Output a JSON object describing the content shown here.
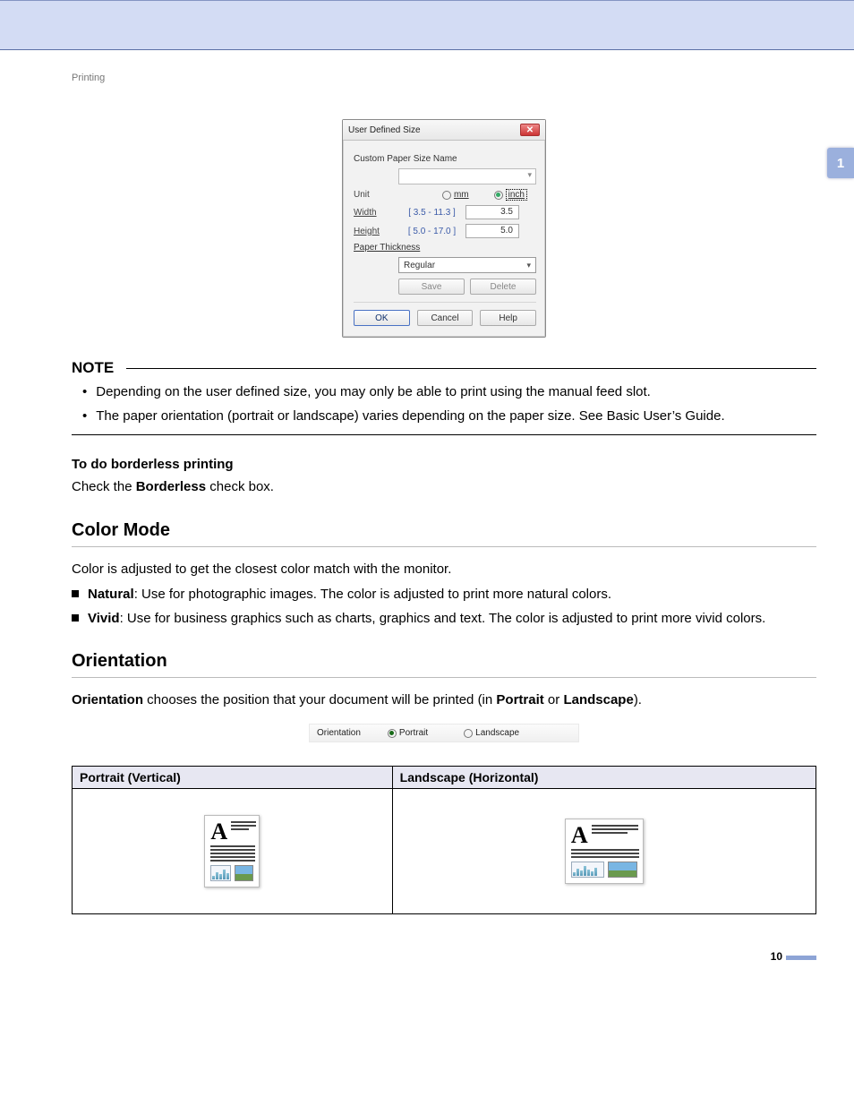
{
  "breadcrumb": "Printing",
  "chapter_tab": "1",
  "page_number": "10",
  "dialog": {
    "title": "User Defined Size",
    "label_custom_name": "Custom Paper Size Name",
    "name_value": "",
    "label_unit": "Unit",
    "radio_mm": "mm",
    "radio_inch": "inch",
    "label_width": "Width",
    "range_width": "[ 3.5 - 11.3 ]",
    "value_width": "3.5",
    "label_height": "Height",
    "range_height": "[ 5.0 - 17.0 ]",
    "value_height": "5.0",
    "label_thickness": "Paper Thickness",
    "thickness_value": "Regular",
    "btn_save": "Save",
    "btn_delete": "Delete",
    "btn_ok": "OK",
    "btn_cancel": "Cancel",
    "btn_help": "Help"
  },
  "note": {
    "heading": "NOTE",
    "items": [
      "Depending on the user defined size, you may only be able to print using the manual feed slot.",
      "The paper orientation (portrait or landscape) varies depending on the paper size. See Basic User’s Guide."
    ]
  },
  "borderless": {
    "heading": "To do borderless printing",
    "text_pre": "Check the ",
    "text_bold": "Borderless",
    "text_post": " check box."
  },
  "color_mode": {
    "heading": "Color Mode",
    "intro": "Color is adjusted to get the closest color match with the monitor.",
    "items": [
      {
        "label": "Natural",
        "desc": ": Use for photographic images. The color is adjusted to print more natural colors."
      },
      {
        "label": "Vivid",
        "desc": ": Use for business graphics such as charts, graphics and text. The color is adjusted to print more vivid colors."
      }
    ]
  },
  "orientation": {
    "heading": "Orientation",
    "sentence": {
      "b1": "Orientation",
      "mid": " chooses the position that your document will be printed (in ",
      "b2": "Portrait",
      "mid2": " or ",
      "b3": "Landscape",
      "end": ")."
    },
    "snippet": {
      "label": "Orientation",
      "opt1": "Portrait",
      "opt2": "Landscape"
    },
    "table": {
      "col1": "Portrait (Vertical)",
      "col2": "Landscape (Horizontal)"
    }
  }
}
